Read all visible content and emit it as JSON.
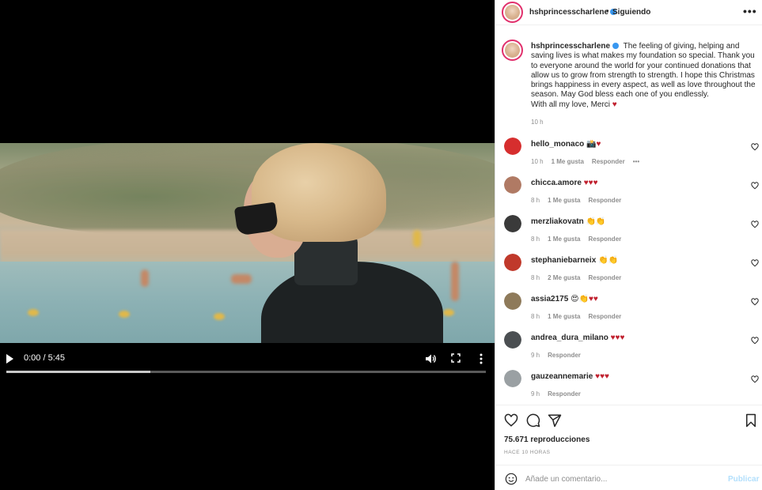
{
  "video": {
    "time": "0:00 / 5:45",
    "progress": 0.3
  },
  "post": {
    "username": "hshprincesscharlene",
    "dot": "•",
    "follow_label": "Siguiendo",
    "more": "•••",
    "caption_user": "hshprincesscharlene",
    "caption_text": "The feeling of giving, helping and saving lives is what makes my foundation so special. Thank you to everyone around the world for your continued donations that allow us to grow from strength to strength. I hope this Christmas brings happiness in every aspect, as well as love throughout the season. May God bless each one of you endlessly.",
    "caption_sign": "With all my love, Merci ♥",
    "caption_time": "10 h"
  },
  "comments": [
    {
      "user": "hello_monaco",
      "text": "📸♥",
      "time": "10 h",
      "likes": "1 Me gusta",
      "reply": "Responder",
      "more": "•••",
      "avatar_color": "#d62e2e"
    },
    {
      "user": "chicca.amore",
      "text": "♥♥♥",
      "time": "8 h",
      "likes": "1 Me gusta",
      "reply": "Responder",
      "avatar_color": "#b07a64"
    },
    {
      "user": "merzliakovatn",
      "text": "👏👏",
      "time": "8 h",
      "likes": "1 Me gusta",
      "reply": "Responder",
      "avatar_color": "#3a3a3a"
    },
    {
      "user": "stephaniebarneix",
      "text": "👏👏",
      "time": "8 h",
      "likes": "2 Me gusta",
      "reply": "Responder",
      "avatar_color": "#c0392b"
    },
    {
      "user": "assia2175",
      "text": "😍👏♥♥",
      "time": "8 h",
      "likes": "1 Me gusta",
      "reply": "Responder",
      "avatar_color": "#8e7a5a"
    },
    {
      "user": "andrea_dura_milano",
      "text": "♥♥♥",
      "time": "9 h",
      "likes": "",
      "reply": "Responder",
      "avatar_color": "#4b4f52"
    },
    {
      "user": "gauzeannemarie",
      "text": "♥♥♥",
      "time": "9 h",
      "likes": "",
      "reply": "Responder",
      "avatar_color": "#9aa0a3"
    }
  ],
  "stats": {
    "views": "75.671 reproducciones",
    "ago": "HACE 10 HORAS"
  },
  "add_comment": {
    "placeholder": "Añade un comentario...",
    "publish": "Publicar"
  },
  "icons": [
    "play-icon",
    "volume-icon",
    "fullscreen-icon",
    "more-vertical-icon",
    "heart-icon",
    "comment-icon",
    "share-icon",
    "bookmark-icon",
    "emoji-icon"
  ],
  "colors": {
    "verified": "#3897f0",
    "heart_red": "#c0202e",
    "publish_disabled": "#b2dffc"
  }
}
